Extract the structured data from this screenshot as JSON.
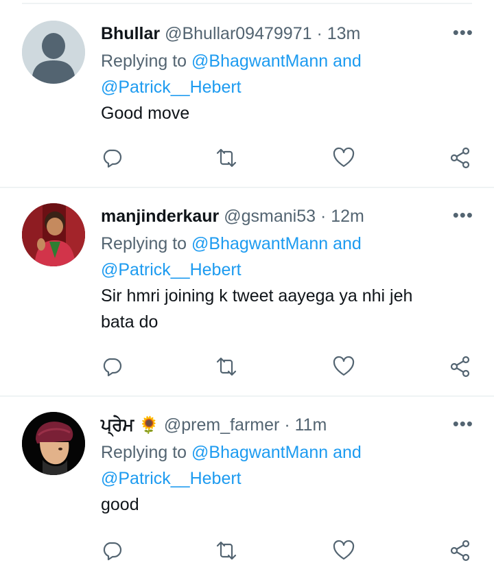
{
  "tweets": [
    {
      "name": "Bhullar",
      "handle": "@Bhullar09479971",
      "time": "13m",
      "replying_prefix": "Replying to ",
      "mention1": "@BhagwantMann",
      "and_word": " and",
      "mention2": "@Patrick__Hebert",
      "text_lines": [
        "Good move"
      ],
      "avatar": "default-avatar"
    },
    {
      "name": "manjinderkaur",
      "handle": "@gsmani53",
      "time": "12m",
      "replying_prefix": "Replying to ",
      "mention1": "@BhagwantMann",
      "and_word": " and",
      "mention2": "@Patrick__Hebert",
      "text_lines": [
        "Sir hmri joining k tweet aayega ya nhi jeh",
        "bata do"
      ],
      "avatar": "photo-avatar-child"
    },
    {
      "name": "ਪ੍ਰੇਮ",
      "emoji": "🌻",
      "handle": "@prem_farmer",
      "time": "11m",
      "replying_prefix": "Replying to ",
      "mention1": "@BhagwantMann",
      "and_word": " and",
      "mention2": "@Patrick__Hebert",
      "text_lines": [
        "good"
      ],
      "avatar": "cartoon-avatar-turban"
    }
  ],
  "separator": "·",
  "more_label": "•••",
  "icons": [
    "reply-icon",
    "retweet-icon",
    "like-icon",
    "share-icon"
  ],
  "colors": {
    "link": "#1d9bf0",
    "secondary": "#536471",
    "primary": "#0f1419",
    "divider": "#eff3f4"
  }
}
